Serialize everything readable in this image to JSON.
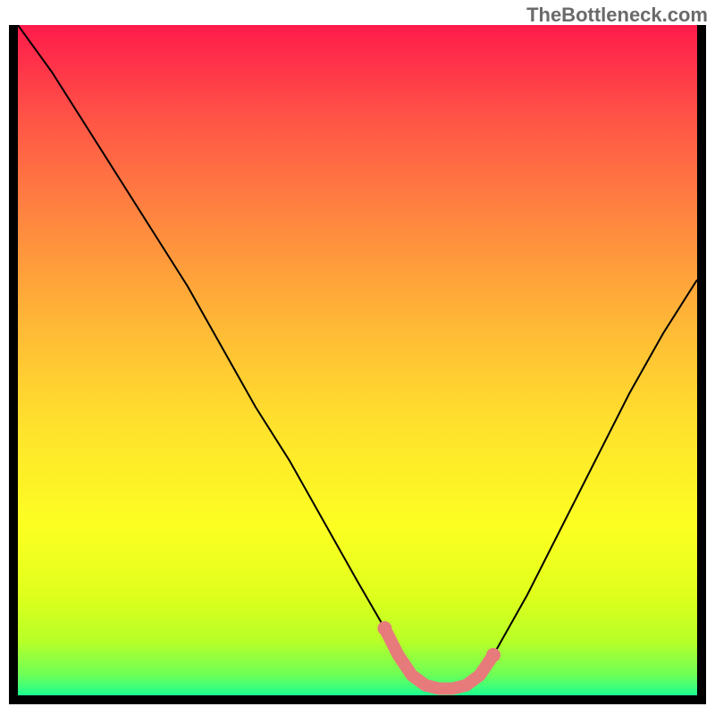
{
  "watermark": "TheBottleneck.com",
  "chart_data": {
    "type": "line",
    "title": "",
    "xlabel": "",
    "ylabel": "",
    "xlim": [
      0,
      100
    ],
    "ylim": [
      0,
      100
    ],
    "series": [
      {
        "name": "curve",
        "x": [
          0,
          5,
          10,
          15,
          20,
          25,
          30,
          35,
          40,
          45,
          50,
          54,
          56,
          58,
          60,
          62,
          64,
          66,
          68,
          70,
          75,
          80,
          85,
          90,
          95,
          100
        ],
        "values": [
          100,
          93,
          85,
          77,
          69,
          61,
          52,
          43,
          35,
          26,
          17,
          10,
          6,
          3,
          1.5,
          1,
          1,
          1.5,
          3,
          6,
          15,
          25,
          35,
          45,
          54,
          62
        ]
      }
    ],
    "markers": {
      "name": "highlight-band",
      "color": "#e77b7b",
      "x": [
        54,
        56,
        58,
        60,
        62,
        64,
        66,
        68,
        70
      ],
      "values": [
        10,
        6,
        3,
        1.5,
        1,
        1,
        1.5,
        3,
        6
      ]
    },
    "gradient_stops": [
      {
        "offset": 0.0,
        "color": "#ff1b4b"
      },
      {
        "offset": 0.05,
        "color": "#ff2f4a"
      },
      {
        "offset": 0.15,
        "color": "#ff5846"
      },
      {
        "offset": 0.3,
        "color": "#ff8a3f"
      },
      {
        "offset": 0.45,
        "color": "#ffb936"
      },
      {
        "offset": 0.6,
        "color": "#ffe22c"
      },
      {
        "offset": 0.75,
        "color": "#fcff22"
      },
      {
        "offset": 0.85,
        "color": "#dfff1c"
      },
      {
        "offset": 0.92,
        "color": "#b7ff28"
      },
      {
        "offset": 0.97,
        "color": "#6cff58"
      },
      {
        "offset": 1.0,
        "color": "#1cff91"
      }
    ]
  }
}
